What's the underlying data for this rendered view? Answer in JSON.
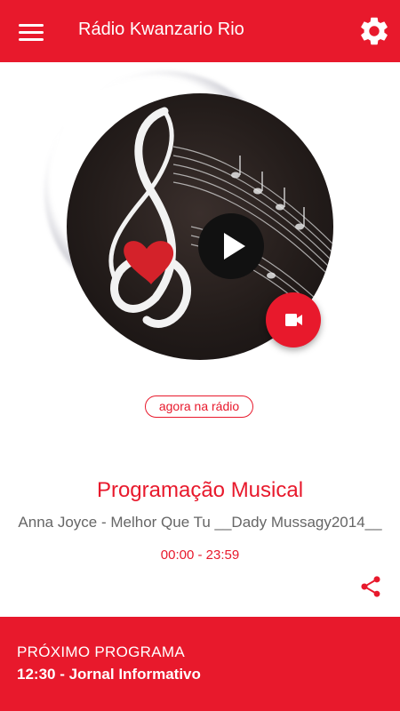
{
  "app_bar": {
    "title": "Rádio Kwanzario Rio",
    "menu_icon": "menu-icon",
    "settings_icon": "gear-icon",
    "background": "#e8192c"
  },
  "player": {
    "artwork": "treble-clef-heart-music-notes",
    "play_icon": "play-icon",
    "video_icon": "video-camera-icon",
    "now_label": "agora na rádio"
  },
  "program": {
    "title": "Programação Musical",
    "track": "Anna Joyce - Melhor Que Tu __Dady Mussagy2014__",
    "time": "00:00 - 23:59",
    "share_icon": "share-icon"
  },
  "next": {
    "label": "PRÓXIMO PROGRAMA",
    "program": "12:30 - Jornal Informativo"
  },
  "colors": {
    "accent": "#e8192c",
    "text_muted": "#666666"
  }
}
